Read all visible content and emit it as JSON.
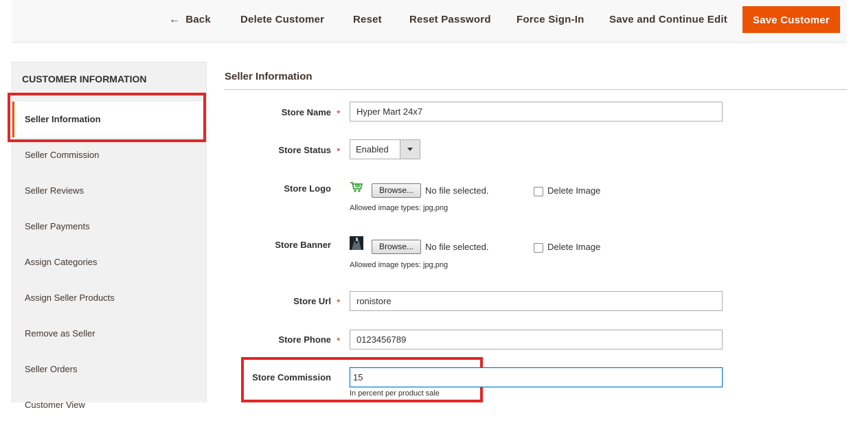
{
  "toolbar": {
    "back": "Back",
    "delete": "Delete Customer",
    "reset": "Reset",
    "reset_password": "Reset Password",
    "force_signin": "Force Sign-In",
    "save_continue": "Save and Continue Edit",
    "save": "Save Customer"
  },
  "sidebar": {
    "title": "CUSTOMER INFORMATION",
    "items": [
      {
        "label": "Seller Information",
        "active": true
      },
      {
        "label": "Seller Commission"
      },
      {
        "label": "Seller Reviews"
      },
      {
        "label": "Seller Payments"
      },
      {
        "label": "Assign Categories"
      },
      {
        "label": "Assign Seller Products"
      },
      {
        "label": "Remove as Seller"
      },
      {
        "label": "Seller Orders"
      },
      {
        "label": "Customer View"
      }
    ]
  },
  "form": {
    "title": "Seller Information",
    "store_name": {
      "label": "Store Name",
      "value": "Hyper Mart 24x7"
    },
    "store_status": {
      "label": "Store Status",
      "value": "Enabled"
    },
    "store_logo": {
      "label": "Store Logo",
      "browse": "Browse...",
      "no_file": "No file selected.",
      "delete": "Delete Image",
      "note": "Allowed image types: jpg,png"
    },
    "store_banner": {
      "label": "Store Banner",
      "browse": "Browse...",
      "no_file": "No file selected.",
      "delete": "Delete Image",
      "note": "Allowed image types: jpg,png"
    },
    "store_url": {
      "label": "Store Url",
      "value": "ronistore"
    },
    "store_phone": {
      "label": "Store Phone",
      "value": "0123456789"
    },
    "store_commission": {
      "label": "Store Commission",
      "value": "15",
      "note": "In percent per product sale"
    },
    "required_mark": "*"
  },
  "colors": {
    "accent": "#eb5202",
    "highlight_box": "#e22626",
    "required": "#e22626"
  }
}
